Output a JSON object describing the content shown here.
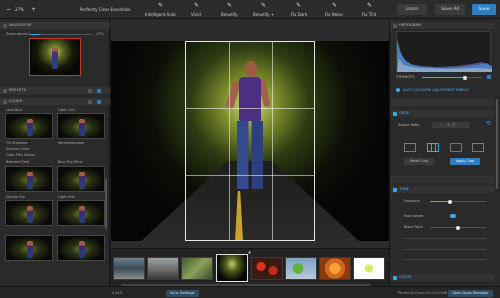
{
  "toolbar": {
    "zoom_value": "27%",
    "preset_name": "Perfectly Clear Essentials",
    "tools": [
      "Intelligent Auto",
      "Vivid",
      "Beautify",
      "Beautify +",
      "Fix Dark",
      "Fix Noise",
      "Fix Tint"
    ],
    "learn_label": "Learn",
    "save_all_label": "Save All",
    "save_label": "Save"
  },
  "navigator": {
    "title": "NAVIGATOR",
    "zoom_label": "Zoom percent",
    "zoom_value": "27%"
  },
  "presets": {
    "title": "PRESETS"
  },
  "looks": {
    "title": "LOOKS",
    "items": [
      {
        "label": "Lens Blue"
      },
      {
        "label": "Light 20%"
      },
      {
        "label": "Tilt Shadows"
      },
      {
        "label": "Windowshaded"
      },
      {
        "label": "Bearded Field"
      },
      {
        "label": "Blue Pop Rime"
      },
      {
        "label": "Double Dip"
      },
      {
        "label": "Light Hills"
      }
    ],
    "group_1": "Stylized Color",
    "group_2": "Color Film Stocks"
  },
  "right": {
    "histogram_title": "HISTOGRAM",
    "strength_label": "STRENGTH",
    "strength_value": 0.72,
    "auto_collapse_label": "AUTO COLLAPSE ADJUSTMENT PANELS",
    "crop_title": "CROP",
    "aspect_label": "Aspect Ratio",
    "aspect_value": "5 : 7",
    "reset_crop_label": "Reset Crop",
    "apply_crop_label": "Apply Crop",
    "tone_title": "TONE",
    "exposure_label": "Exposure",
    "exposure_value": 0.35,
    "face_aware_label": "Face Aware",
    "black_point_label": "Black Point",
    "color_title": "COLOR"
  },
  "bottom": {
    "page_info": "4 of 9",
    "sync_label": "Sync Settings",
    "version_info": "Perfectly Clear v3.5.0.1566",
    "open_apps_label": "Open Apps Manager"
  },
  "colors": {
    "accent": "#3ea7f0",
    "save_button": "#2f7ec1",
    "apply_crop": "#2f7ec1",
    "selected_thumb": "#d8453a"
  }
}
